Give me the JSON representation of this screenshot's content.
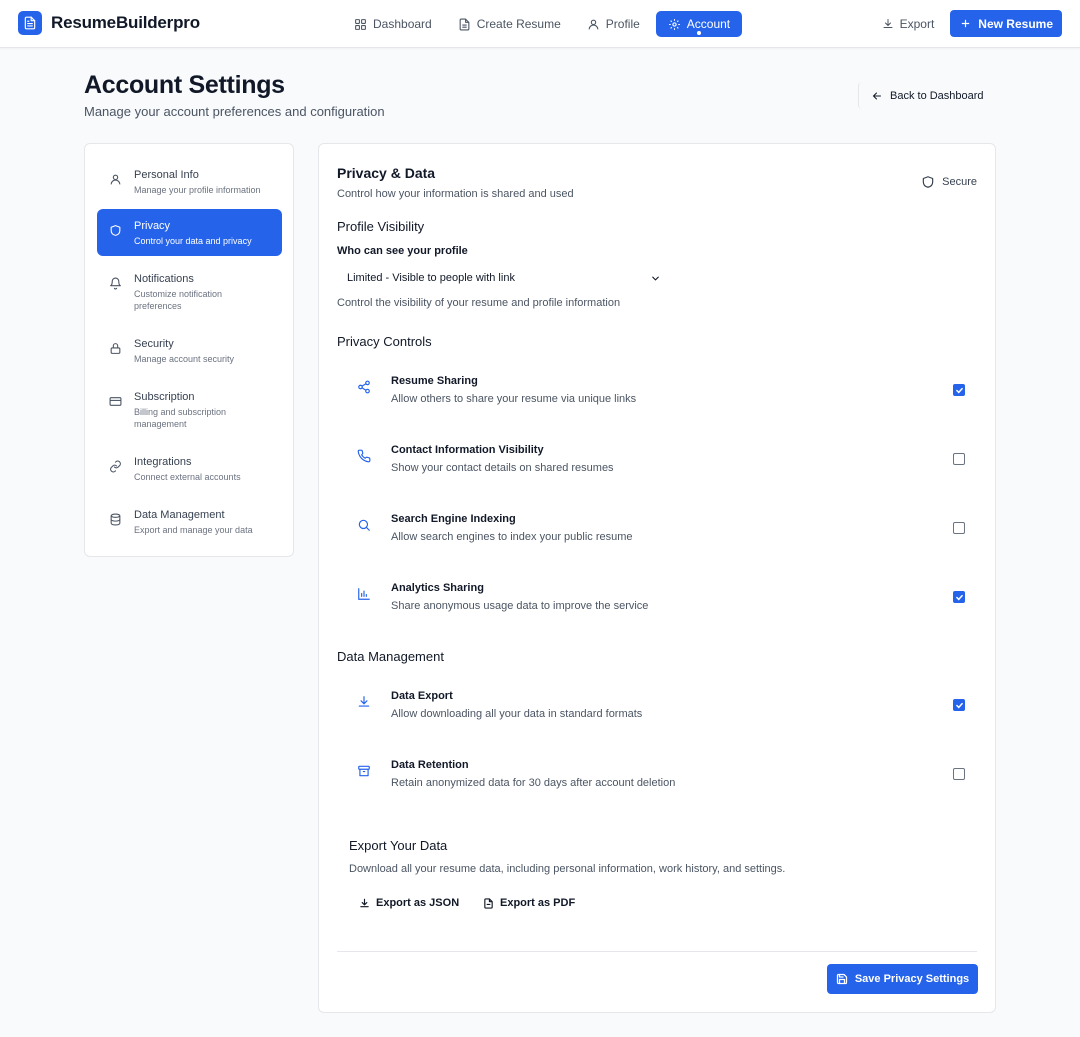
{
  "app": {
    "brand": "ResumeBuilderpro"
  },
  "nav": [
    {
      "label": "Dashboard",
      "icon": "dashboard-icon"
    },
    {
      "label": "Create Resume",
      "icon": "document-icon"
    },
    {
      "label": "Profile",
      "icon": "user-icon"
    },
    {
      "label": "Account",
      "icon": "gear-icon",
      "active": true
    }
  ],
  "topbar": {
    "export_label": "Export",
    "new_resume_label": "New Resume"
  },
  "header": {
    "title": "Account Settings",
    "subtitle": "Manage your account preferences and configuration",
    "back_label": "Back to Dashboard"
  },
  "sidebar": {
    "items": [
      {
        "title": "Personal Info",
        "desc": "Manage your profile information",
        "icon": "user-icon"
      },
      {
        "title": "Privacy",
        "desc": "Control your data and privacy",
        "icon": "shield-icon",
        "active": true
      },
      {
        "title": "Notifications",
        "desc": "Customize notification preferences",
        "icon": "bell-icon"
      },
      {
        "title": "Security",
        "desc": "Manage account security",
        "icon": "lock-icon"
      },
      {
        "title": "Subscription",
        "desc": "Billing and subscription management",
        "icon": "credit-card-icon"
      },
      {
        "title": "Integrations",
        "desc": "Connect external accounts",
        "icon": "link-icon"
      },
      {
        "title": "Data Management",
        "desc": "Export and manage your data",
        "icon": "database-icon"
      }
    ]
  },
  "main": {
    "title": "Privacy & Data",
    "subtitle": "Control how your information is shared and used",
    "badge": "Secure",
    "visibility": {
      "title": "Profile Visibility",
      "label": "Who can see your profile",
      "selected": "Limited - Visible to people with link",
      "hint": "Control the visibility of your resume and profile information"
    },
    "privacy_controls_title": "Privacy Controls",
    "privacy_controls": [
      {
        "title": "Resume Sharing",
        "desc": "Allow others to share your resume via unique links",
        "checked": true,
        "icon": "share-icon"
      },
      {
        "title": "Contact Information Visibility",
        "desc": "Show your contact details on shared resumes",
        "checked": false,
        "icon": "phone-icon"
      },
      {
        "title": "Search Engine Indexing",
        "desc": "Allow search engines to index your public resume",
        "checked": false,
        "icon": "search-icon"
      },
      {
        "title": "Analytics Sharing",
        "desc": "Share anonymous usage data to improve the service",
        "checked": true,
        "icon": "bar-chart-icon"
      }
    ],
    "data_management_title": "Data Management",
    "data_controls": [
      {
        "title": "Data Export",
        "desc": "Allow downloading all your data in standard formats",
        "checked": true,
        "icon": "download-icon"
      },
      {
        "title": "Data Retention",
        "desc": "Retain anonymized data for 30 days after account deletion",
        "checked": false,
        "icon": "archive-icon"
      }
    ],
    "export": {
      "title": "Export Your Data",
      "desc": "Download all your resume data, including personal information, work history, and settings.",
      "json_label": "Export as JSON",
      "pdf_label": "Export as PDF"
    },
    "save_label": "Save Privacy Settings"
  },
  "colors": {
    "accent": "#2563eb",
    "background": "#f8fafc"
  }
}
